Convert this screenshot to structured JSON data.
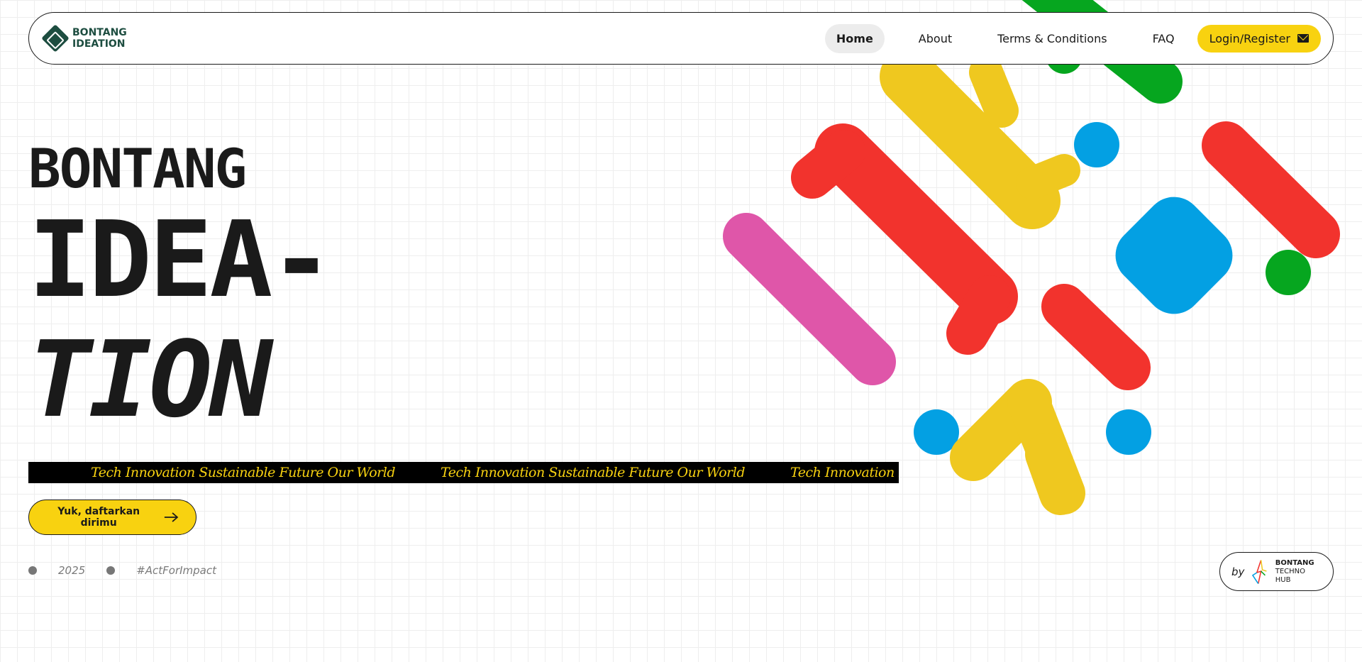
{
  "nav": {
    "brand_line1": "BONTANG",
    "brand_line2": "IDEATION",
    "links": [
      "Home",
      "About",
      "Terms & Conditions",
      "FAQ"
    ],
    "active": "Home",
    "login_label": "Login/Register"
  },
  "hero": {
    "line1": "BONTANG",
    "line2": "IDEA-",
    "line3": "TION"
  },
  "ticker": {
    "items": [
      "Tech Innovation Sustainable Future Our World",
      "Tech Innovation Sustainable Future Our World",
      "Tech Innovation Sustainable Future Our World"
    ]
  },
  "cta": {
    "label": "Yuk, daftarkan dirimu"
  },
  "meta": {
    "year": "2025",
    "hashtag": "#ActForImpact"
  },
  "badge": {
    "by": "by",
    "org_line1": "BONTANG",
    "org_line2": "TECHNO HUB"
  },
  "colors": {
    "accent_yellow": "#f8d210",
    "brand_green": "#1d4d40",
    "shape_red": "#f2332d",
    "shape_yellow": "#efc81f",
    "shape_green": "#06a61f",
    "shape_blue": "#03a0e3",
    "shape_pink": "#df56a9"
  },
  "icons": [
    "logo-icon",
    "mail-icon",
    "arrow-right-icon",
    "techno-hub-logo-icon"
  ]
}
